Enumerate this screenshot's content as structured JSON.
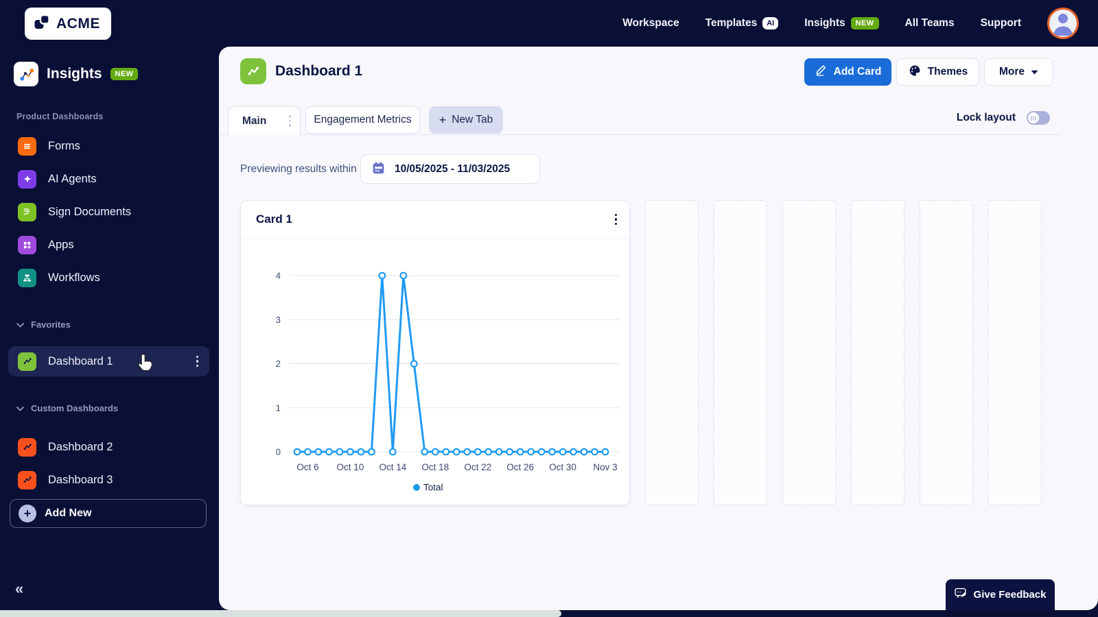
{
  "brand": {
    "logo_text": "ACME"
  },
  "top_nav": {
    "workspace": "Workspace",
    "templates": "Templates",
    "templates_badge": "AI",
    "insights": "Insights",
    "insights_badge": "NEW",
    "all_teams": "All Teams",
    "support": "Support"
  },
  "sidebar": {
    "app_title": "Insights",
    "app_badge": "NEW",
    "sections": {
      "product": "Product Dashboards",
      "favorites": "Favorites",
      "custom": "Custom Dashboards"
    },
    "product_items": [
      {
        "label": "Forms"
      },
      {
        "label": "AI Agents"
      },
      {
        "label": "Sign Documents"
      },
      {
        "label": "Apps"
      },
      {
        "label": "Workflows"
      }
    ],
    "favorite_items": [
      {
        "label": "Dashboard 1"
      }
    ],
    "custom_items": [
      {
        "label": "Dashboard 2"
      },
      {
        "label": "Dashboard 3"
      }
    ],
    "add_new": "Add New",
    "collapse_glyph": "«"
  },
  "header": {
    "title": "Dashboard 1",
    "add_card": "Add Card",
    "themes": "Themes",
    "more": "More"
  },
  "tabs": {
    "main": "Main",
    "engagement": "Engagement Metrics",
    "new_tab_plus": "+",
    "new_tab": "New Tab",
    "lock_layout": "Lock layout"
  },
  "filter": {
    "label": "Previewing results within",
    "date_range": "10/05/2025 - 11/03/2025"
  },
  "card": {
    "title": "Card 1"
  },
  "chart_data": {
    "type": "line",
    "title": "Card 1",
    "x": [
      "Oct 5",
      "Oct 6",
      "Oct 7",
      "Oct 8",
      "Oct 9",
      "Oct 10",
      "Oct 11",
      "Oct 12",
      "Oct 13",
      "Oct 14",
      "Oct 15",
      "Oct 16",
      "Oct 17",
      "Oct 18",
      "Oct 19",
      "Oct 20",
      "Oct 21",
      "Oct 22",
      "Oct 23",
      "Oct 24",
      "Oct 25",
      "Oct 26",
      "Oct 27",
      "Oct 28",
      "Oct 29",
      "Oct 30",
      "Oct 31",
      "Nov 1",
      "Nov 2",
      "Nov 3"
    ],
    "series": [
      {
        "name": "Total",
        "color": "#1f9bf3",
        "values": [
          0,
          0,
          0,
          0,
          0,
          0,
          0,
          0,
          4,
          0,
          4,
          2,
          0,
          0,
          0,
          0,
          0,
          0,
          0,
          0,
          0,
          0,
          0,
          0,
          0,
          0,
          0,
          0,
          0,
          0
        ]
      }
    ],
    "x_ticks": [
      {
        "index": 1,
        "label": "Oct 6"
      },
      {
        "index": 5,
        "label": "Oct 10"
      },
      {
        "index": 9,
        "label": "Oct 14"
      },
      {
        "index": 13,
        "label": "Oct 18"
      },
      {
        "index": 17,
        "label": "Oct 22"
      },
      {
        "index": 21,
        "label": "Oct 26"
      },
      {
        "index": 25,
        "label": "Oct 30"
      },
      {
        "index": 29,
        "label": "Nov 3"
      }
    ],
    "y_ticks": [
      0,
      1,
      2,
      3,
      4
    ],
    "ylim": [
      0,
      4
    ],
    "grid": true,
    "legend": [
      {
        "label": "Total",
        "color": "#1f9bf3"
      }
    ],
    "legend_position": "bottom"
  },
  "feedback": {
    "label": "Give Feedback"
  },
  "colors": {
    "navy_bg": "#0a0f36",
    "panel_bg": "#f8f8fc",
    "accent_blue": "#1a6cd9",
    "chart_blue": "#1f9bf3",
    "badge_green": "#64ab12",
    "dashboard_green": "#7ec23c",
    "forms_orange": "#fb6a0f",
    "dashboard_orange": "#f8501c",
    "ai_purple": "#7d3ce8",
    "apps_purple": "#a04bdc",
    "sign_lime": "#7ec226",
    "workflows_teal": "#0f9184",
    "avatar_ring_orange": "#e2622b",
    "text_navy": "#0c1445"
  }
}
